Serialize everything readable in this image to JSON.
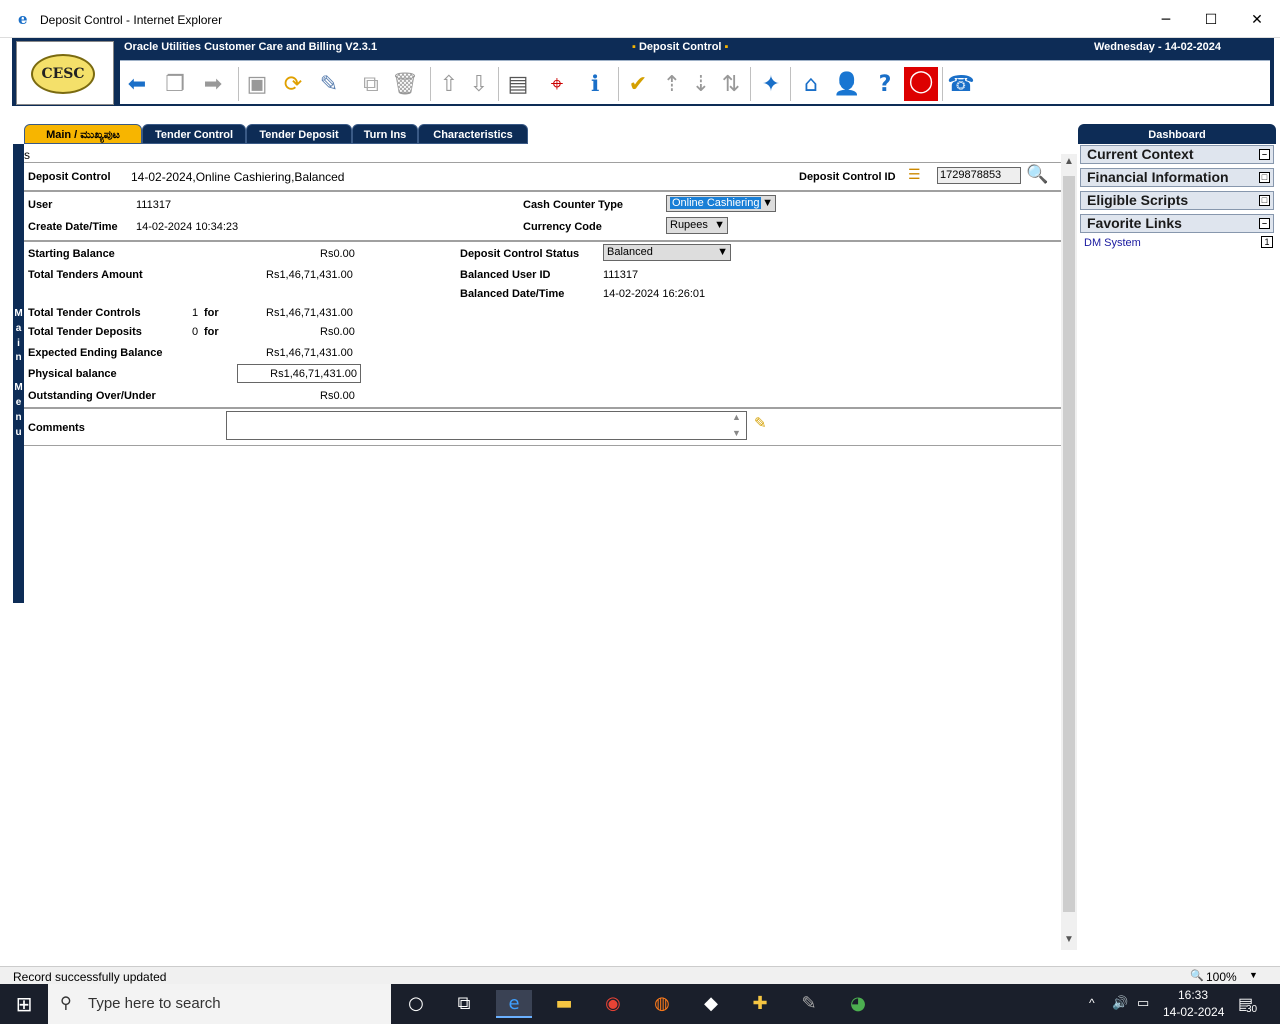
{
  "window": {
    "title": "Deposit Control - Internet Explorer",
    "minimize": "─",
    "maximize": "☐",
    "close": "✕"
  },
  "app": {
    "product": "Oracle Utilities Customer Care and Billing V2.3.1",
    "page": "Deposit Control",
    "date": "Wednesday - 14-02-2024",
    "logo_text": "CESC"
  },
  "tabs": [
    {
      "label": "Main / ಮುಖ್ಯಪುಟ",
      "active": true
    },
    {
      "label": "Tender Control"
    },
    {
      "label": "Tender Deposit"
    },
    {
      "label": "Turn Ins"
    },
    {
      "label": "Characteristics"
    }
  ],
  "side_menu": {
    "letters": [
      "M",
      "a",
      "i",
      "n",
      "M",
      "e",
      "n",
      "u"
    ]
  },
  "form": {
    "s_marker": "s",
    "deposit_control_label": "Deposit Control",
    "deposit_control_value": "14-02-2024,Online Cashiering,Balanced",
    "deposit_control_id_label": "Deposit Control ID",
    "deposit_control_id_value": "1729878853",
    "user_label": "User",
    "user_value": "111317",
    "create_label": "Create Date/Time",
    "create_value": "14-02-2024 10:34:23",
    "cash_counter_label": "Cash Counter Type",
    "cash_counter_value": "Online Cashiering",
    "currency_label": "Currency Code",
    "currency_value": "Rupees",
    "starting_balance_label": "Starting Balance",
    "starting_balance_value": "Rs0.00",
    "total_tenders_label": "Total Tenders Amount",
    "total_tenders_value": "Rs1,46,71,431.00",
    "status_label": "Deposit Control Status",
    "status_value": "Balanced",
    "balanced_user_label": "Balanced User ID",
    "balanced_user_value": "111317",
    "balanced_date_label": "Balanced Date/Time",
    "balanced_date_value": "14-02-2024 16:26:01",
    "total_tender_controls_label": "Total Tender Controls",
    "total_tender_controls_count": "1",
    "for_1": "for",
    "total_tender_controls_value": "Rs1,46,71,431.00",
    "total_tender_deposits_label": "Total Tender Deposits",
    "total_tender_deposits_count": "0",
    "for_2": "for",
    "total_tender_deposits_value": "Rs0.00",
    "expected_label": "Expected Ending Balance",
    "expected_value": "Rs1,46,71,431.00",
    "physical_label": "Physical balance",
    "physical_value": "Rs1,46,71,431.00",
    "outstanding_label": "Outstanding Over/Under",
    "outstanding_value": "Rs0.00",
    "comments_label": "Comments",
    "comments_value": ""
  },
  "dashboard": {
    "title": "Dashboard",
    "sections": [
      {
        "label": "Current Context",
        "ctl": "–"
      },
      {
        "label": "Financial Information",
        "ctl": "□"
      },
      {
        "label": "Eligible Scripts",
        "ctl": "□"
      },
      {
        "label": "Favorite Links",
        "ctl": "–"
      }
    ],
    "link": "DM System",
    "link_badge": "1"
  },
  "status": {
    "message": "Record successfully updated",
    "zoom": "100%"
  },
  "taskbar": {
    "search_placeholder": "Type here to search",
    "time": "16:33",
    "date": "14-02-2024",
    "notif_count": "30"
  }
}
